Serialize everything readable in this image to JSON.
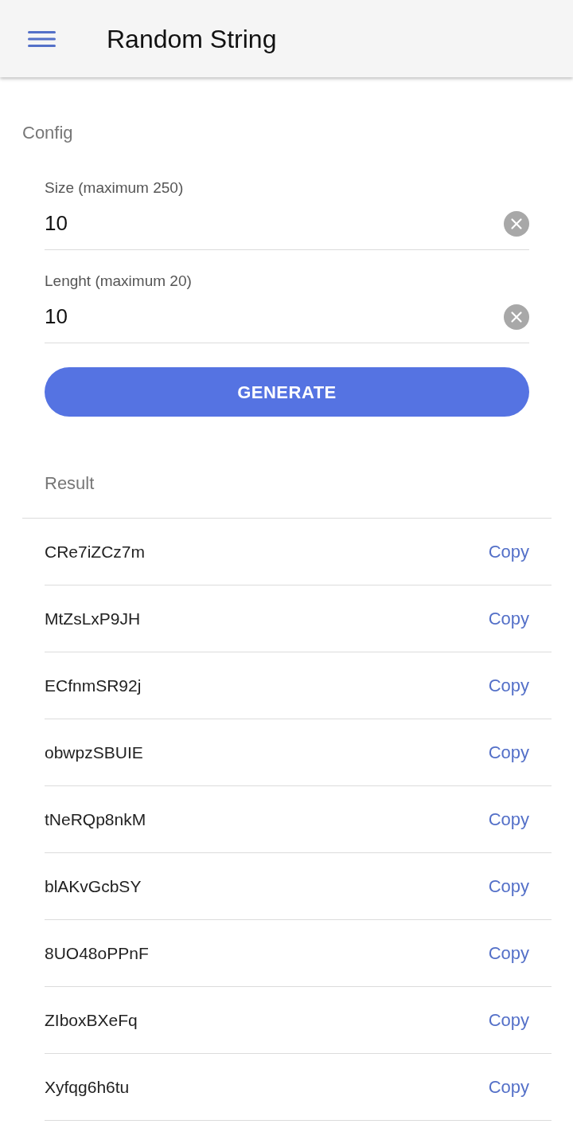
{
  "app_bar": {
    "title": "Random String"
  },
  "config": {
    "heading": "Config",
    "fields": [
      {
        "label": "Size (maximum 250)",
        "value": "10"
      },
      {
        "label": "Lenght (maximum 20)",
        "value": "10"
      }
    ],
    "generate_button": "GENERATE"
  },
  "result": {
    "heading": "Result",
    "rows": [
      {
        "text": "CRe7iZCz7m",
        "action": "Copy"
      },
      {
        "text": "MtZsLxP9JH",
        "action": "Copy"
      },
      {
        "text": "ECfnmSR92j",
        "action": "Copy"
      },
      {
        "text": "obwpzSBUIE",
        "action": "Copy"
      },
      {
        "text": "tNeRQp8nkM",
        "action": "Copy"
      },
      {
        "text": "blAKvGcbSY",
        "action": "Copy"
      },
      {
        "text": "8UO48oPPnF",
        "action": "Copy"
      },
      {
        "text": "ZIboxBXeFq",
        "action": "Copy"
      },
      {
        "text": "Xyfqg6h6tu",
        "action": "Copy"
      }
    ]
  }
}
